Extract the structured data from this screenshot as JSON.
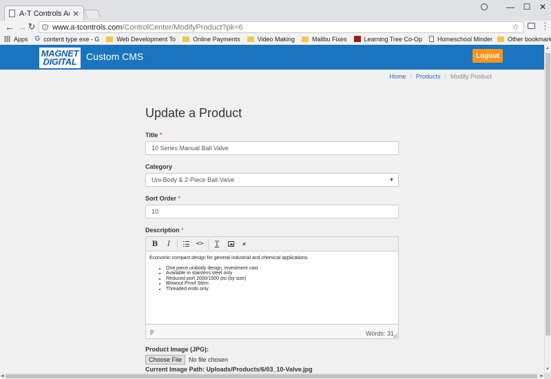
{
  "browser": {
    "tab_title": "A-T Controls Administrati",
    "url_host": "www.a-tcontrols.com",
    "url_path": "/ControlCenter/ModifyProduct?pk=6",
    "bookmarks": [
      {
        "icon": "apps-icon",
        "label": "Apps"
      },
      {
        "icon": "google-icon",
        "label": "content type exe - G"
      },
      {
        "icon": "folder-icon",
        "label": "Web Development To"
      },
      {
        "icon": "folder-icon",
        "label": "Online Payments"
      },
      {
        "icon": "folder-icon",
        "label": "Video Making"
      },
      {
        "icon": "folder-icon",
        "label": "Malibu Fixes"
      },
      {
        "icon": "site-icon",
        "label": "Learning Tree Co-Op"
      },
      {
        "icon": "doc-icon",
        "label": "Homeschool Minder"
      }
    ],
    "other_bookmarks": "Other bookmarks"
  },
  "header": {
    "logo_line1": "MAGNET",
    "logo_line2": "DIGITAL",
    "brand": "Custom CMS",
    "logout_label": "Logout",
    "accent_color": "#1a74be",
    "button_color": "#f7941d"
  },
  "breadcrumb": {
    "home": "Home",
    "products": "Products",
    "current": "Modify Product"
  },
  "form": {
    "title": "Update a Product",
    "required_mark": "*",
    "title_label": "Title",
    "title_value": "10 Series Manual Ball Valve",
    "category_label": "Category",
    "category_value": "Uni-Body & 2-Piece Ball Valve",
    "sort_label": "Sort Order",
    "sort_value": "10",
    "description_label": "Description",
    "description": {
      "intro": "Economic compact design for general industrial and chemical applications.",
      "bullets": [
        "One piece unibody design, investment cast",
        "Available in stainless steel only",
        "Reduced port 2000/1500 psi (by size)",
        "Blowout Proof Stem",
        "Threaded ends only"
      ]
    },
    "editor_toolbar": [
      "bold-icon",
      "italic-icon",
      "bullet-list-icon",
      "code-icon",
      "clear-format-icon",
      "image-icon",
      "link-icon"
    ],
    "editor_path": "p",
    "word_count": "Words: 31",
    "image_label": "Product Image (JPG):",
    "choose_file": "Choose File",
    "no_file": "No file chosen",
    "image_path": "Current Image Path: Uploads/Products/6/03_10-Valve.jpg"
  }
}
